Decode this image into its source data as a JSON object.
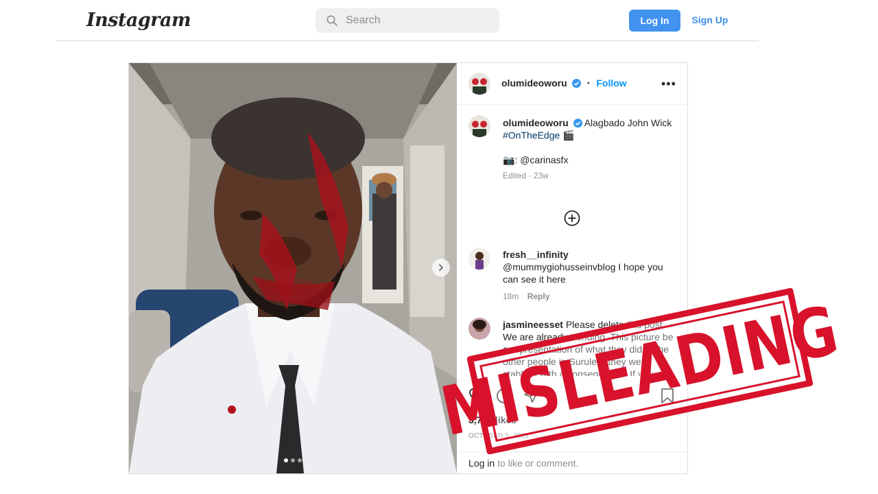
{
  "header": {
    "logo": "Instagram",
    "search_placeholder": "Search",
    "login_label": "Log In",
    "signup_label": "Sign Up"
  },
  "post": {
    "username": "olumideoworu",
    "follow_label": "Follow",
    "more_label": "•••",
    "caption": {
      "username": "olumideoworu",
      "line1": "Alagbado John Wick",
      "hashtag": "#OnTheEdge",
      "hashtag_emoji": "🎬",
      "camera_emoji": "📷",
      "credit": ": @carinasfx",
      "meta": "Edited · 23w"
    },
    "comments": [
      {
        "username": "fresh__infinity",
        "text": "@mummygiohusseinvblog I hope you can see it here",
        "time": "18m",
        "reply_label": "Reply"
      },
      {
        "username": "jasmineesset",
        "text": "Please delete this post. We are already trending. This picture be a representation of what they did to the other people in Surulere they were stabbed with a consequence. If you"
      }
    ],
    "likes_text": "3,755 likes",
    "date": "OCTOBER 5, 2022",
    "login_prompt_link": "Log in",
    "login_prompt_rest": " to like or comment."
  },
  "stamp": {
    "text": "MISLEADING",
    "color": "#d7122a"
  },
  "colors": {
    "primary_button": "#4193ef",
    "link_blue": "#0095f6",
    "verified_blue": "#3797f0"
  },
  "icons": [
    "search-icon",
    "verified-icon",
    "more-icon",
    "add-icon",
    "chevron-right-icon",
    "heart-icon",
    "comment-icon",
    "share-icon",
    "bookmark-icon"
  ]
}
